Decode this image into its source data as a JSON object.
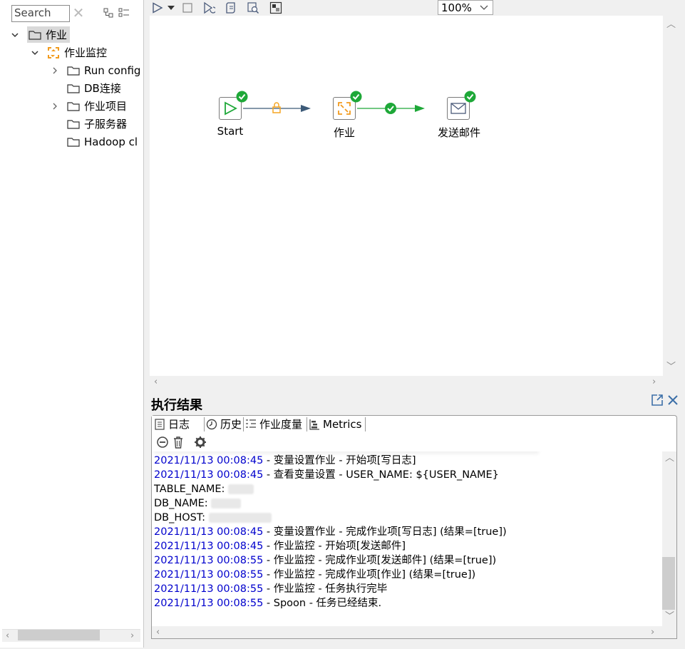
{
  "left_panel": {
    "search": {
      "placeholder": "Search"
    },
    "tree": {
      "root": {
        "label": "作业"
      },
      "job": {
        "label": "作业监控"
      },
      "children": [
        {
          "label": "Run config",
          "expandable": true
        },
        {
          "label": "DB连接",
          "expandable": false
        },
        {
          "label": "作业项目",
          "expandable": true
        },
        {
          "label": "子服务器",
          "expandable": false
        },
        {
          "label": "Hadoop cl",
          "expandable": false
        }
      ]
    }
  },
  "toolbar": {
    "zoom": "100%"
  },
  "canvas": {
    "nodes": [
      {
        "label": "Start",
        "icon": "start-icon"
      },
      {
        "label": "作业",
        "icon": "job-icon"
      },
      {
        "label": "发送邮件",
        "icon": "mail-icon"
      }
    ]
  },
  "results": {
    "title": "执行结果",
    "tabs": [
      {
        "label": "日志",
        "icon": "log-icon"
      },
      {
        "label": "历史",
        "icon": "history-icon"
      },
      {
        "label": "作业度量",
        "icon": "metrics-list-icon"
      },
      {
        "label": "Metrics",
        "icon": "metrics-chart-icon"
      }
    ],
    "log_lines": [
      {
        "ts": "2021/11/13 00:08:45",
        "text": " - 变量设置作业 - 开始项[写日志]"
      },
      {
        "ts": "2021/11/13 00:08:45",
        "text": " - 查看变量设置 - USER_NAME: ${USER_NAME}"
      },
      {
        "ts": "",
        "text": "TABLE_NAME:"
      },
      {
        "ts": "",
        "text": "DB_NAME:"
      },
      {
        "ts": "",
        "text": "DB_HOST:"
      },
      {
        "ts": "2021/11/13 00:08:45",
        "text": " - 变量设置作业 - 完成作业项[写日志] (结果=[true])"
      },
      {
        "ts": "2021/11/13 00:08:45",
        "text": " - 作业监控 - 开始项[发送邮件]"
      },
      {
        "ts": "2021/11/13 00:08:55",
        "text": " - 作业监控 - 完成作业项[发送邮件] (结果=[true])"
      },
      {
        "ts": "2021/11/13 00:08:55",
        "text": " - 作业监控 - 完成作业项[作业] (结果=[true])"
      },
      {
        "ts": "2021/11/13 00:08:55",
        "text": " - 作业监控 - 任务执行完毕"
      },
      {
        "ts": "2021/11/13 00:08:55",
        "text": " - Spoon - 任务已经结束."
      }
    ]
  },
  "colors": {
    "timestamp": "#0000cd",
    "success_green": "#1ea838",
    "hop_dark": "#3c5a78",
    "hop_green": "#1ea838",
    "lock_orange": "#f5a623",
    "job_orange": "#f29b1e"
  }
}
